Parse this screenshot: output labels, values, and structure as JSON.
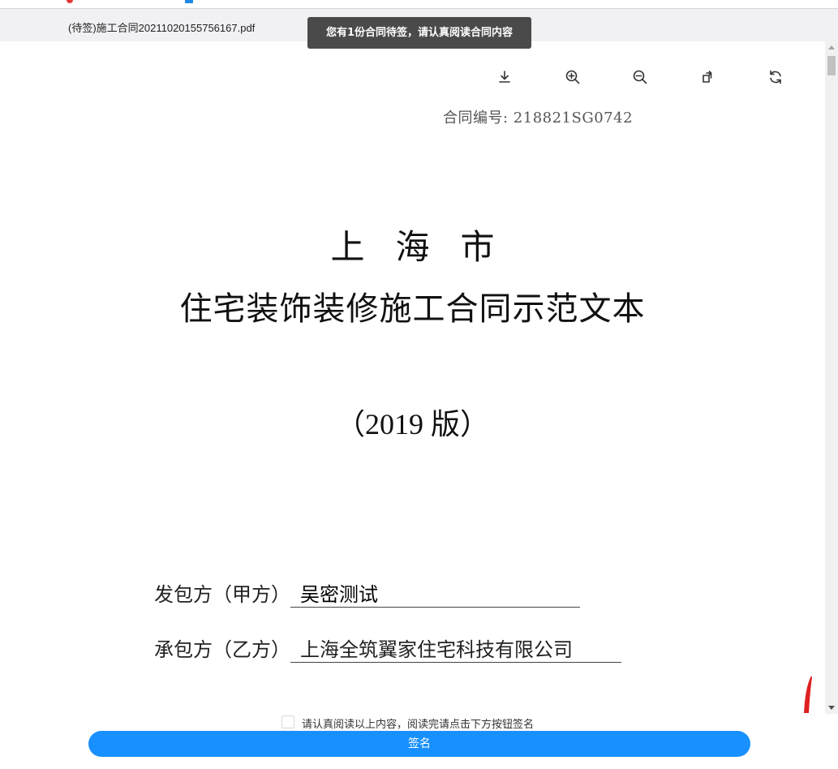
{
  "file": {
    "name": "(待签)施工合同20211020155756167.pdf"
  },
  "toast": {
    "message": "您有1份合同待签，请认真阅读合同内容"
  },
  "toolbar": {
    "buttons": [
      {
        "icon": "download-icon"
      },
      {
        "icon": "zoom-in-icon"
      },
      {
        "icon": "zoom-out-icon"
      },
      {
        "icon": "rotate-icon"
      },
      {
        "icon": "refresh-icon"
      }
    ]
  },
  "document": {
    "contract_no": "合同编号: 218821SG0742",
    "city": "上海市",
    "title": "住宅装饰装修施工合同示范文本",
    "edition": "（2019 版）",
    "party_a": {
      "label": "发包方（甲方）",
      "value": "吴密测试"
    },
    "party_b": {
      "label": "承包方（乙方）",
      "value": "上海全筑翼家住宅科技有限公司"
    }
  },
  "footer": {
    "confirm_text": "请认真阅读以上内容，阅读完请点击下方按钮签名",
    "confirm_checked": false,
    "sign_label": "签名"
  },
  "colors": {
    "accent": "#1890ff",
    "toast_bg": "#4a4a4a",
    "filebar_bg": "#f1f1f4"
  }
}
